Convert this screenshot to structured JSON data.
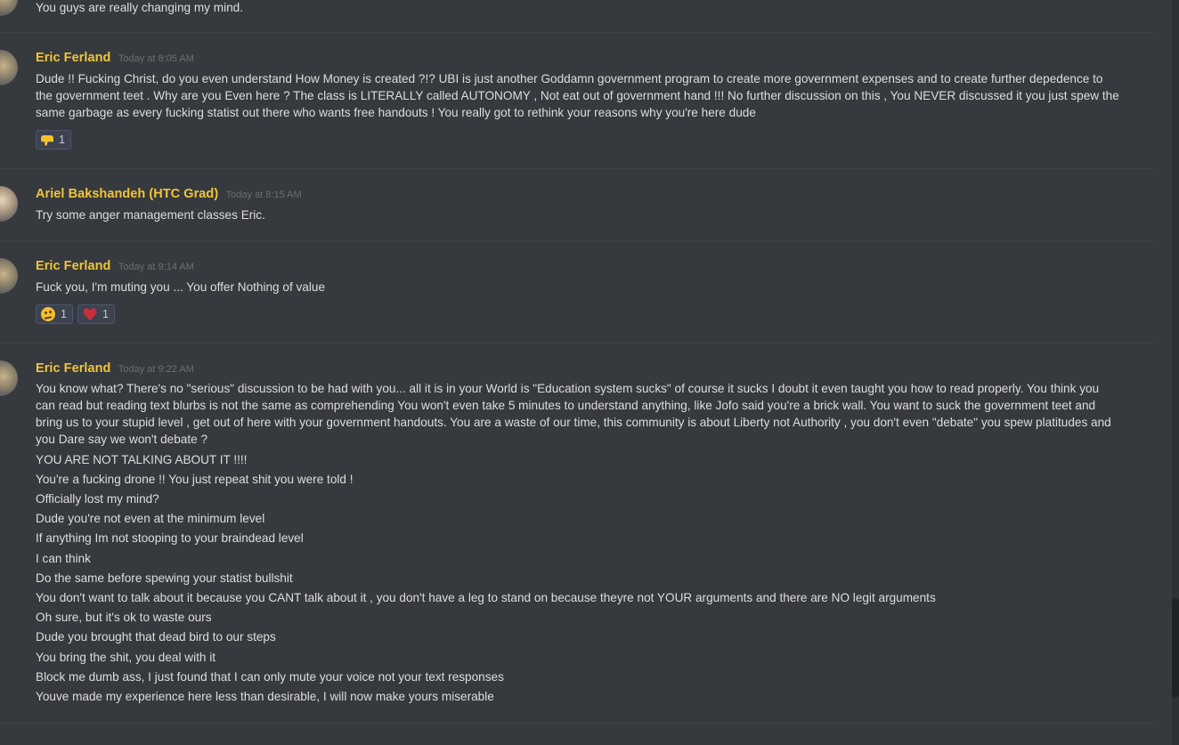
{
  "top_partial": {
    "text": "You guys are really changing my mind."
  },
  "messages": [
    {
      "username": "Eric Ferland",
      "timestamp": "Today at 8:05 AM",
      "lines": [
        "Dude !! Fucking Christ, do you even understand How Money is created ?!? UBI is just another Goddamn government program to create more government expenses and to create further depedence to",
        "the government teet . Why are you Even here ? The class is LITERALLY called AUTONOMY , Not eat out of government hand !!! No further discussion on this , You NEVER discussed it you just spew the",
        "same garbage as every fucking statist out there who wants free handouts ! You really got to rethink your reasons why you're here dude"
      ],
      "reactions": [
        {
          "emoji": "thumbs-down-icon",
          "count": "1"
        }
      ]
    },
    {
      "username": "Ariel Bakshandeh (HTC Grad)",
      "timestamp": "Today at 8:15 AM",
      "lines": [
        "Try some anger management classes Eric."
      ]
    },
    {
      "username": "Eric Ferland",
      "timestamp": "Today at 9:14 AM",
      "lines": [
        "Fuck you, I'm muting you ... You offer Nothing of value"
      ],
      "reactions": [
        {
          "emoji": "thinking-face-icon",
          "count": "1"
        },
        {
          "emoji": "heart-icon",
          "count": "1"
        }
      ]
    },
    {
      "username": "Eric Ferland",
      "timestamp": "Today at 9:22 AM",
      "paragraph": [
        "You know what? There's no \"serious\" discussion to be had with you... all it is in your World is \"Education system sucks\" of course it sucks I doubt it even taught you how to read properly. You think you",
        "can read but reading text blurbs is not the same as comprehending You won't even take 5 minutes to understand anything,  like Jofo said you're a brick wall. You want to suck the government teet  and",
        "bring us to your stupid level , get out of here with your government handouts. You are a waste of our time, this community is about Liberty not Authority , you don't even \"debate\" you spew platitudes and",
        "you Dare say we won't debate ?"
      ],
      "lines": [
        "YOU ARE NOT TALKING ABOUT IT !!!!",
        "You're a fucking drone !! You just repeat shit you were told !",
        "Officially lost my mind?",
        "Dude you're not even at the minimum level",
        "If anything Im not stooping to your braindead level",
        "I can think",
        "Do the same before spewing your statist bullshit",
        "You don't want to talk about it because you CANT talk about it , you don't have a leg to stand on because theyre not YOUR arguments and there are NO legit arguments",
        "Oh sure, but it's ok to waste ours",
        "Dude you brought that dead bird to our steps",
        "You bring the shit, you deal with it",
        "Block me dumb ass, I just found that I can only mute your voice not your text responses",
        "Youve made my experience here less than desirable, I will now make yours miserable"
      ]
    }
  ]
}
